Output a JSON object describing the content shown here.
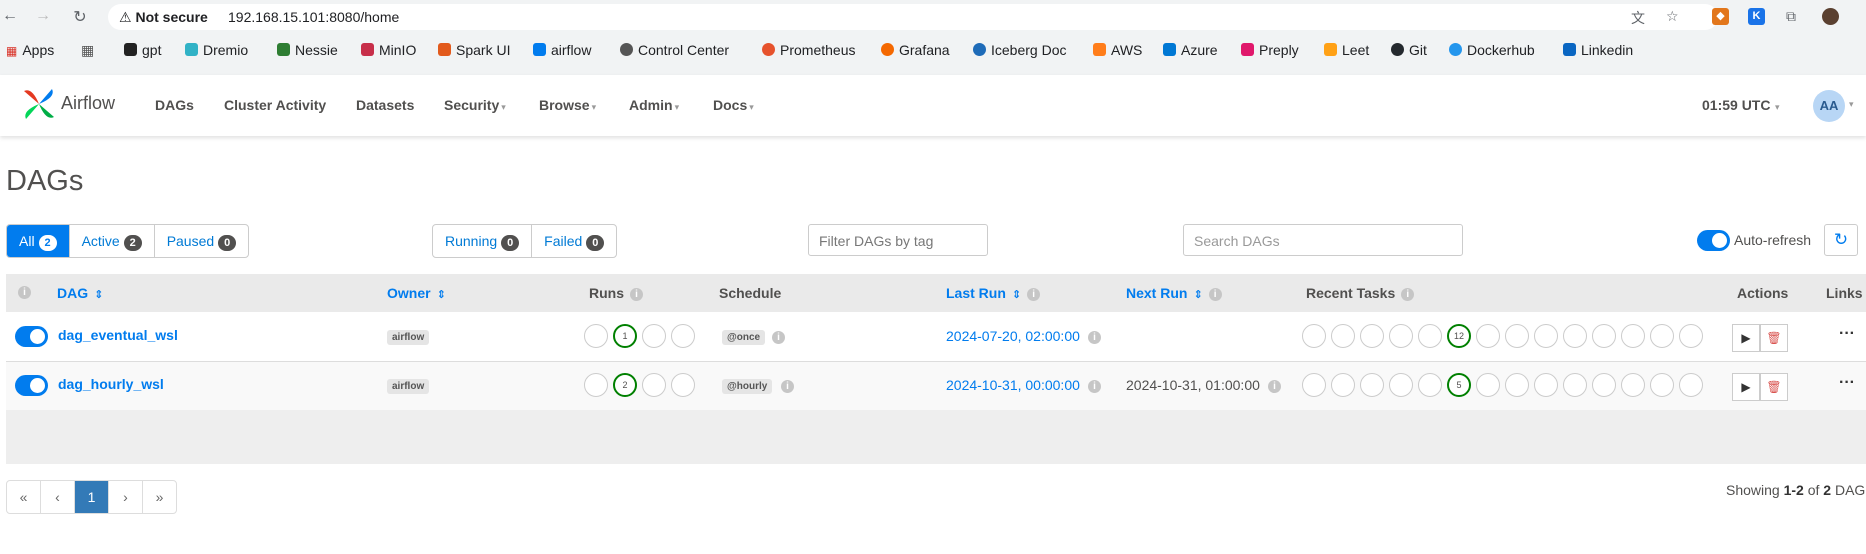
{
  "browser": {
    "not_secure": "Not secure",
    "url": "192.168.15.101:8080/home",
    "bookmarks": [
      "Apps",
      "gpt",
      "Dremio",
      "Nessie",
      "MinIO",
      "Spark UI",
      "airflow",
      "Control Center",
      "Prometheus",
      "Grafana",
      "Iceberg Doc",
      "AWS",
      "Azure",
      "Preply",
      "Leet",
      "Git",
      "Dockerhub",
      "Linkedin"
    ]
  },
  "navbar": {
    "brand": "Airflow",
    "links": [
      "DAGs",
      "Cluster Activity",
      "Datasets",
      "Security",
      "Browse",
      "Admin",
      "Docs"
    ],
    "clock": "01:59 UTC",
    "avatar": "AA"
  },
  "page": {
    "title": "DAGs",
    "filters": {
      "all": "All",
      "all_count": "2",
      "active": "Active",
      "active_count": "2",
      "paused": "Paused",
      "paused_count": "0",
      "running": "Running",
      "running_count": "0",
      "failed": "Failed",
      "failed_count": "0"
    },
    "tag_placeholder": "Filter DAGs by tag",
    "search_placeholder": "Search DAGs",
    "auto_refresh": "Auto-refresh"
  },
  "table": {
    "headers": {
      "dag": "DAG",
      "owner": "Owner",
      "runs": "Runs",
      "schedule": "Schedule",
      "last_run": "Last Run",
      "next_run": "Next Run",
      "recent_tasks": "Recent Tasks",
      "actions": "Actions",
      "links": "Links"
    },
    "rows": [
      {
        "dag_id": "dag_eventual_wsl",
        "owner": "airflow",
        "runs_success": "1",
        "schedule": "@once",
        "last_run": "2024-07-20, 02:00:00",
        "next_run": "",
        "tasks_success": "12"
      },
      {
        "dag_id": "dag_hourly_wsl",
        "owner": "airflow",
        "runs_success": "2",
        "schedule": "@hourly",
        "last_run": "2024-10-31, 00:00:00",
        "next_run": "2024-10-31, 01:00:00",
        "tasks_success": "5"
      }
    ]
  },
  "pager": {
    "first": "«",
    "prev": "‹",
    "page": "1",
    "next": "›",
    "last": "»"
  },
  "showing": {
    "prefix": "Showing",
    "range": "1-2",
    "of": "of",
    "total": "2",
    "suffix": "DAG"
  }
}
